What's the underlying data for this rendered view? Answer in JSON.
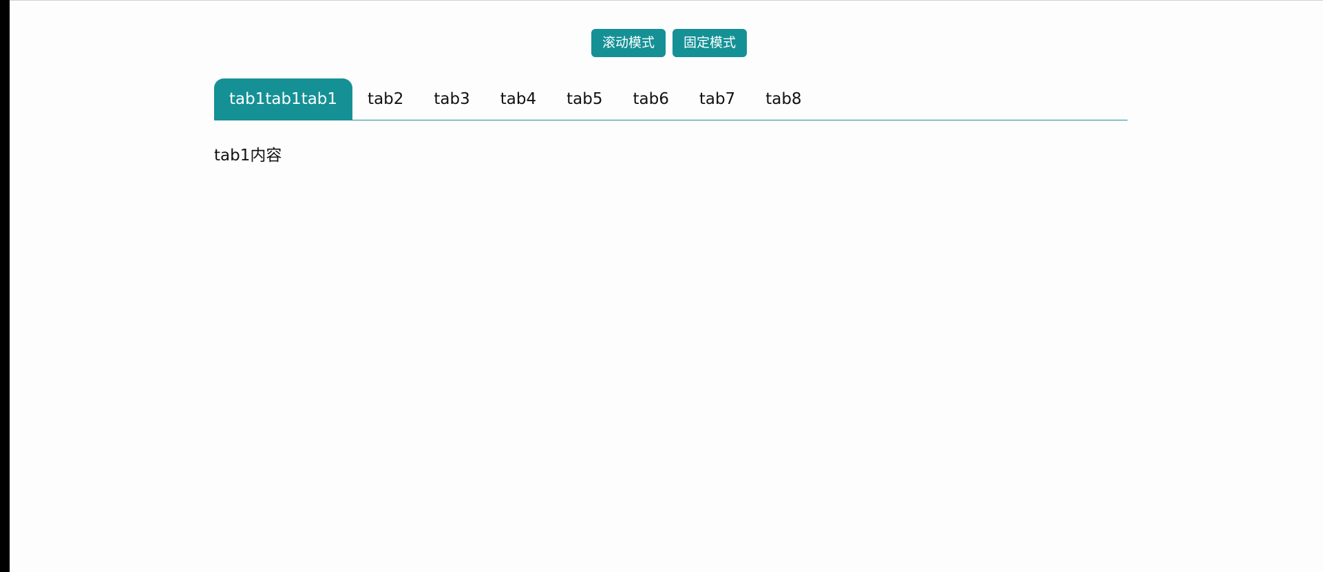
{
  "mode_buttons": {
    "scroll_mode": "滚动模式",
    "fixed_mode": "固定模式"
  },
  "tabs": [
    {
      "label": "tab1tab1tab1",
      "active": true
    },
    {
      "label": "tab2",
      "active": false
    },
    {
      "label": "tab3",
      "active": false
    },
    {
      "label": "tab4",
      "active": false
    },
    {
      "label": "tab5",
      "active": false
    },
    {
      "label": "tab6",
      "active": false
    },
    {
      "label": "tab7",
      "active": false
    },
    {
      "label": "tab8",
      "active": false
    }
  ],
  "content": {
    "text": "tab1内容"
  },
  "colors": {
    "accent": "#159196",
    "background": "#fdfdfd",
    "text": "#111111"
  }
}
